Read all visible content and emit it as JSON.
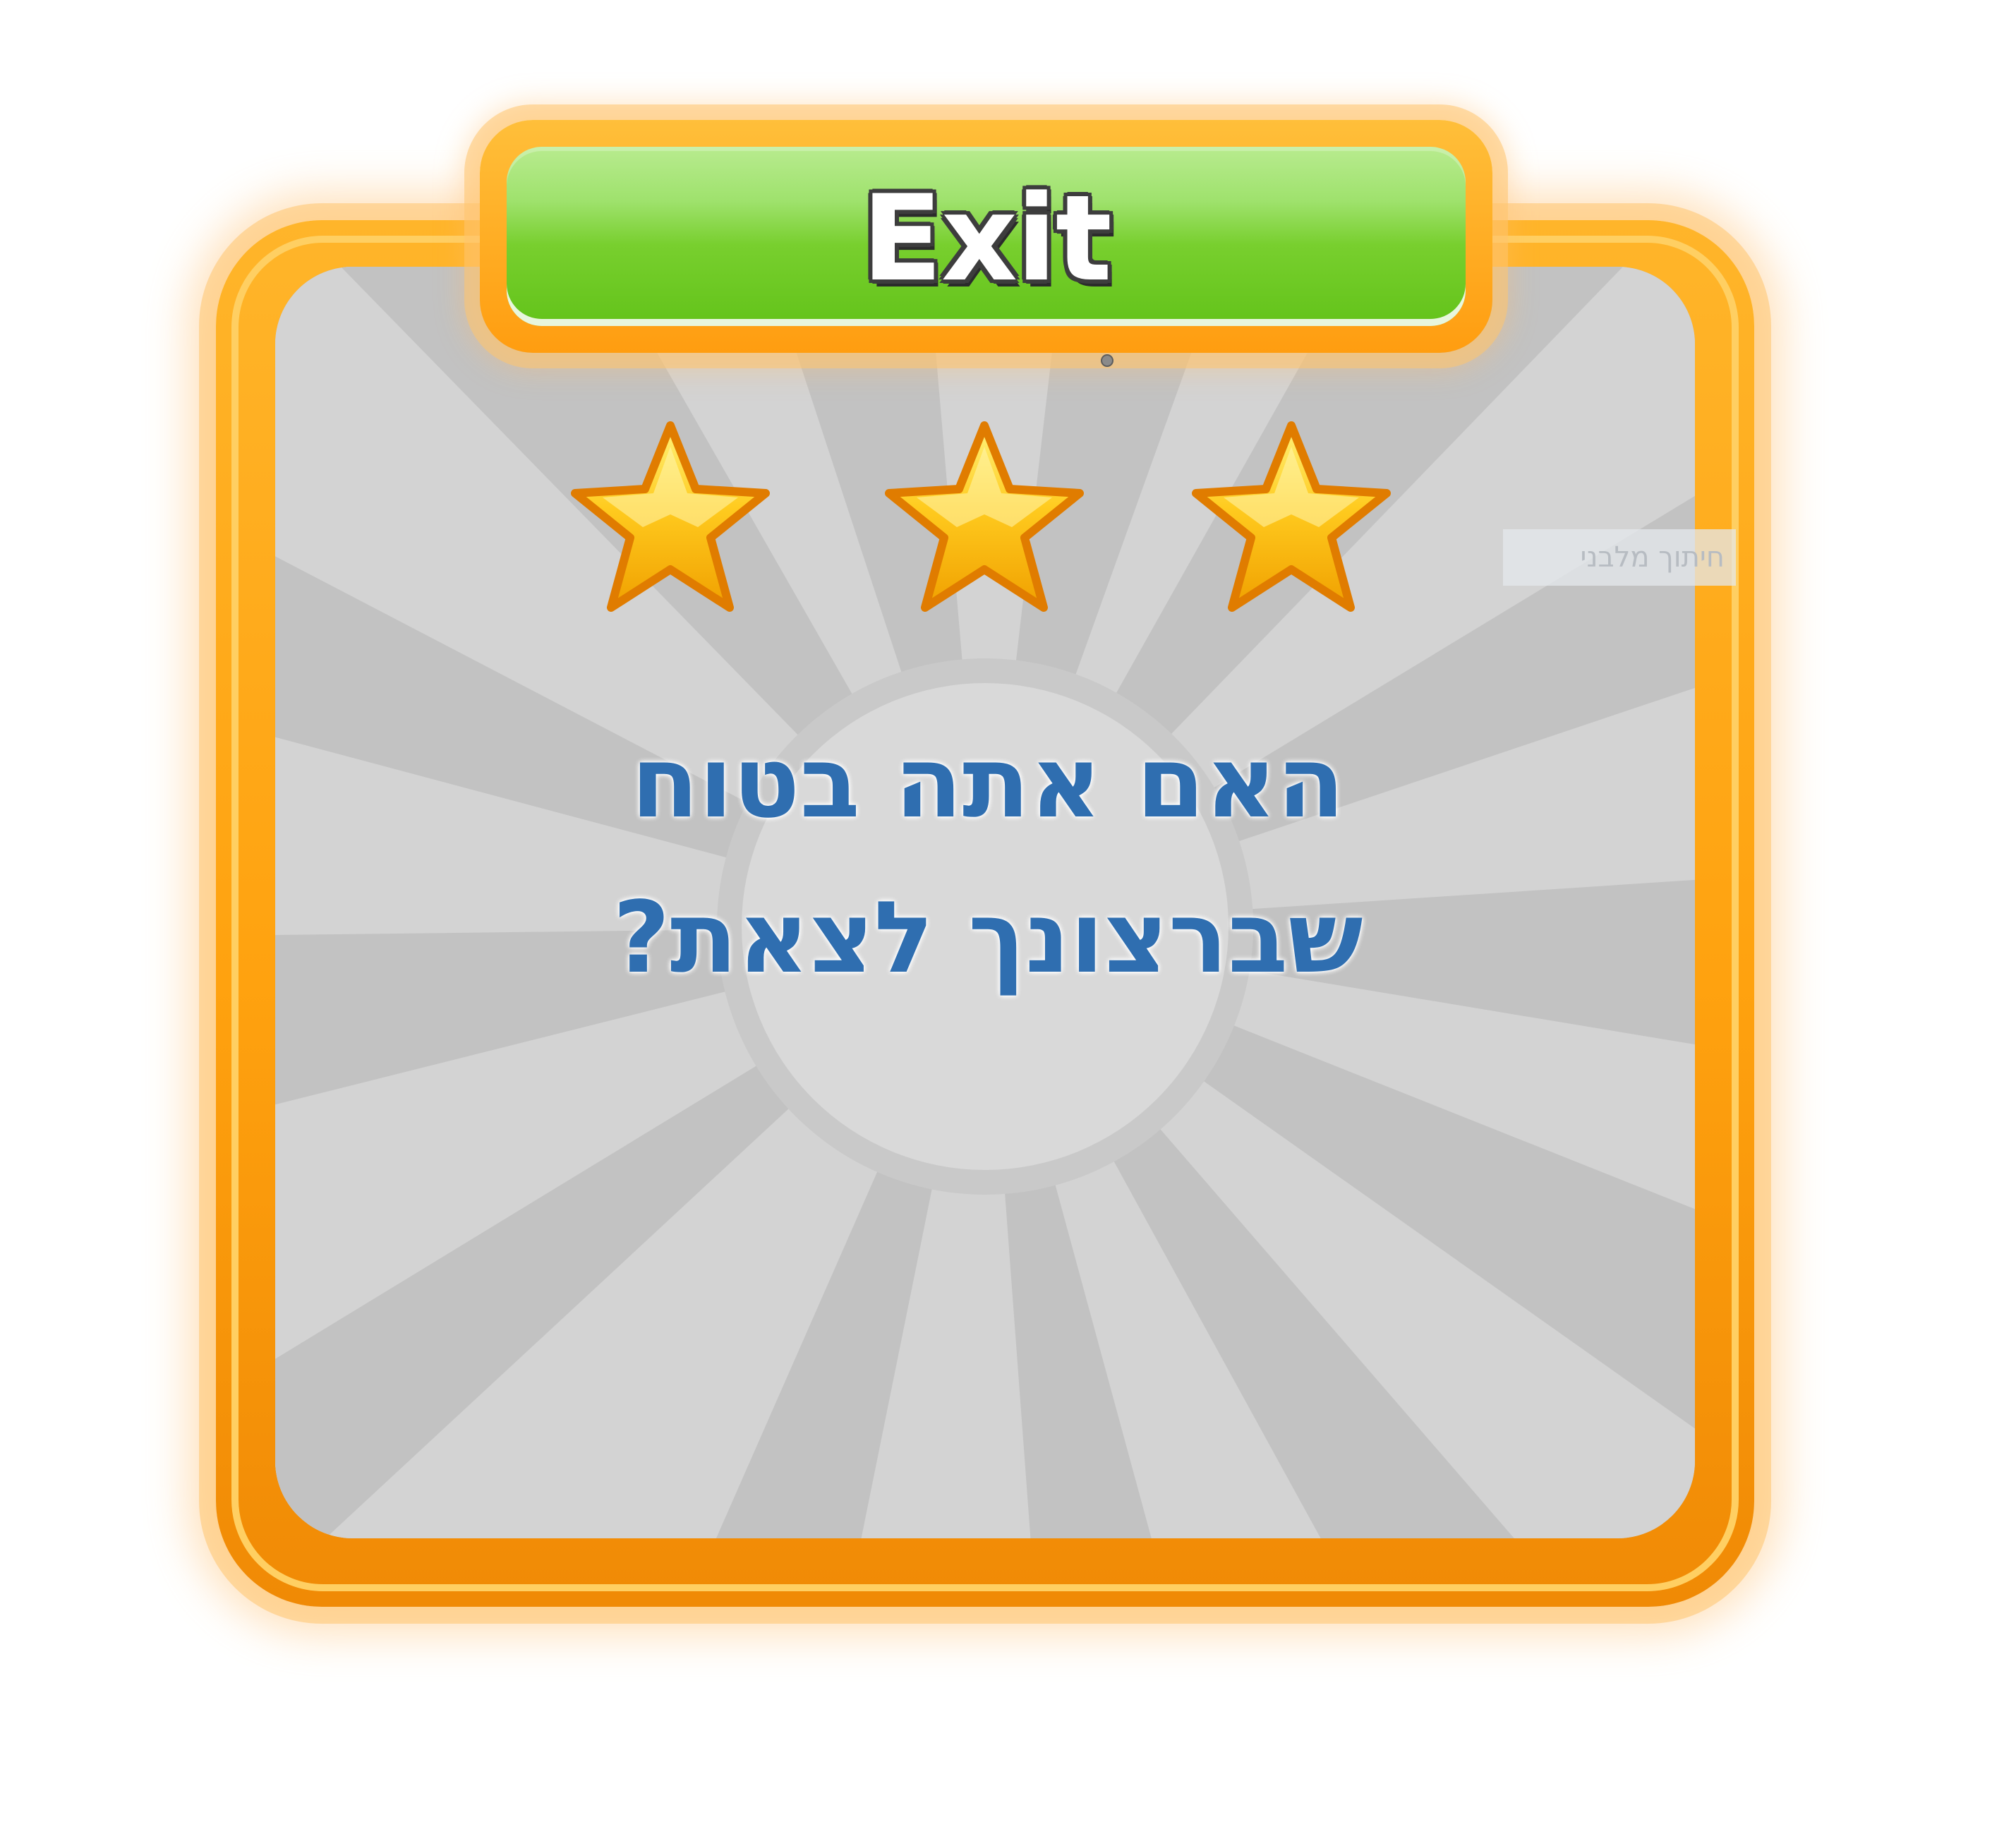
{
  "dialog": {
    "title": "Exit",
    "question_line_1": "האם אתה בטוח",
    "question_line_2": "שברצונך לצאת?"
  },
  "rating": {
    "stars_filled": 3,
    "stars_total": 3
  },
  "side_note": "חיתוך מלבני",
  "colors": {
    "frame_orange": "#ffa20f",
    "title_green": "#78cf2e",
    "panel_gray": "#d8d8d8",
    "question_blue": "#2f6eb0",
    "star_gold": "#ffc21c"
  }
}
